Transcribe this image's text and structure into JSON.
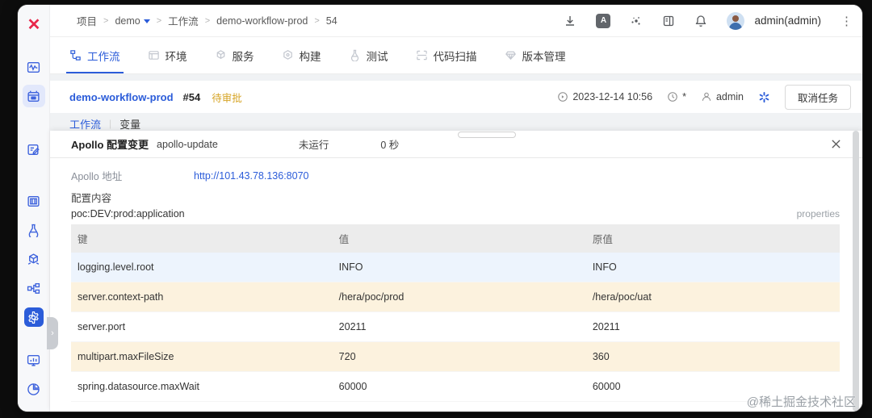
{
  "header": {
    "breadcrumb": {
      "items": [
        "项目",
        "demo",
        "工作流",
        "demo-workflow-prod",
        "54"
      ],
      "sep": ">"
    },
    "actions": {
      "icons": [
        "download-icon",
        "translate-icon",
        "plugin-dots-icon",
        "docs-book-icon",
        "bell-icon"
      ],
      "user": "admin(admin)",
      "kebab": "⋮"
    }
  },
  "sidebar": {
    "logo_glyph": "✕",
    "items": [
      "pulse-monitor-icon",
      "project-board-icon",
      "edit-note-icon",
      "archive-box-icon",
      "flask-icon",
      "package-cube-icon",
      "pipeline-icon",
      "settings-gear-icon",
      "dashboard-monitor-icon",
      "pie-chart-icon"
    ]
  },
  "tabs": [
    {
      "label": "工作流",
      "active": true
    },
    {
      "label": "环境",
      "active": false
    },
    {
      "label": "服务",
      "active": false
    },
    {
      "label": "构建",
      "active": false
    },
    {
      "label": "测试",
      "active": false
    },
    {
      "label": "代码扫描",
      "active": false
    },
    {
      "label": "版本管理",
      "active": false
    }
  ],
  "run": {
    "name": "demo-workflow-prod",
    "number": "#54",
    "status": "待审批",
    "start_time": "2023-12-14 10:56",
    "duration_placeholder": "*",
    "owner": "admin",
    "cancel_label": "取消任务"
  },
  "subtabs": {
    "items": [
      "工作流",
      "变量"
    ],
    "sep": "|"
  },
  "panel": {
    "title": "Apollo 配置变更",
    "step_id": "apollo-update",
    "run_status": "未运行",
    "duration": "0 秒",
    "fields": {
      "address_label": "Apollo 地址",
      "address_value": "http://101.43.78.136:8070",
      "content_label": "配置内容",
      "namespace": "poc:DEV:prod:application",
      "format": "properties"
    },
    "table": {
      "columns": [
        "键",
        "值",
        "原值"
      ],
      "rows": [
        {
          "key": "logging.level.root",
          "value": "INFO",
          "original": "INFO",
          "bg": "blue"
        },
        {
          "key": "server.context-path",
          "value": "/hera/poc/prod",
          "original": "/hera/poc/uat",
          "bg": "cream"
        },
        {
          "key": "server.port",
          "value": "20211",
          "original": "20211",
          "bg": "white"
        },
        {
          "key": "multipart.maxFileSize",
          "value": "720",
          "original": "360",
          "bg": "cream"
        },
        {
          "key": "spring.datasource.maxWait",
          "value": "60000",
          "original": "60000",
          "bg": "white"
        }
      ]
    }
  },
  "watermark": "@稀土掘金技术社区",
  "colors": {
    "accent": "#2b5cd9",
    "status_pending": "#d6a425",
    "row_blue": "#edf4fd",
    "row_cream": "#fcf2de",
    "logo_red": "#e8274b"
  }
}
